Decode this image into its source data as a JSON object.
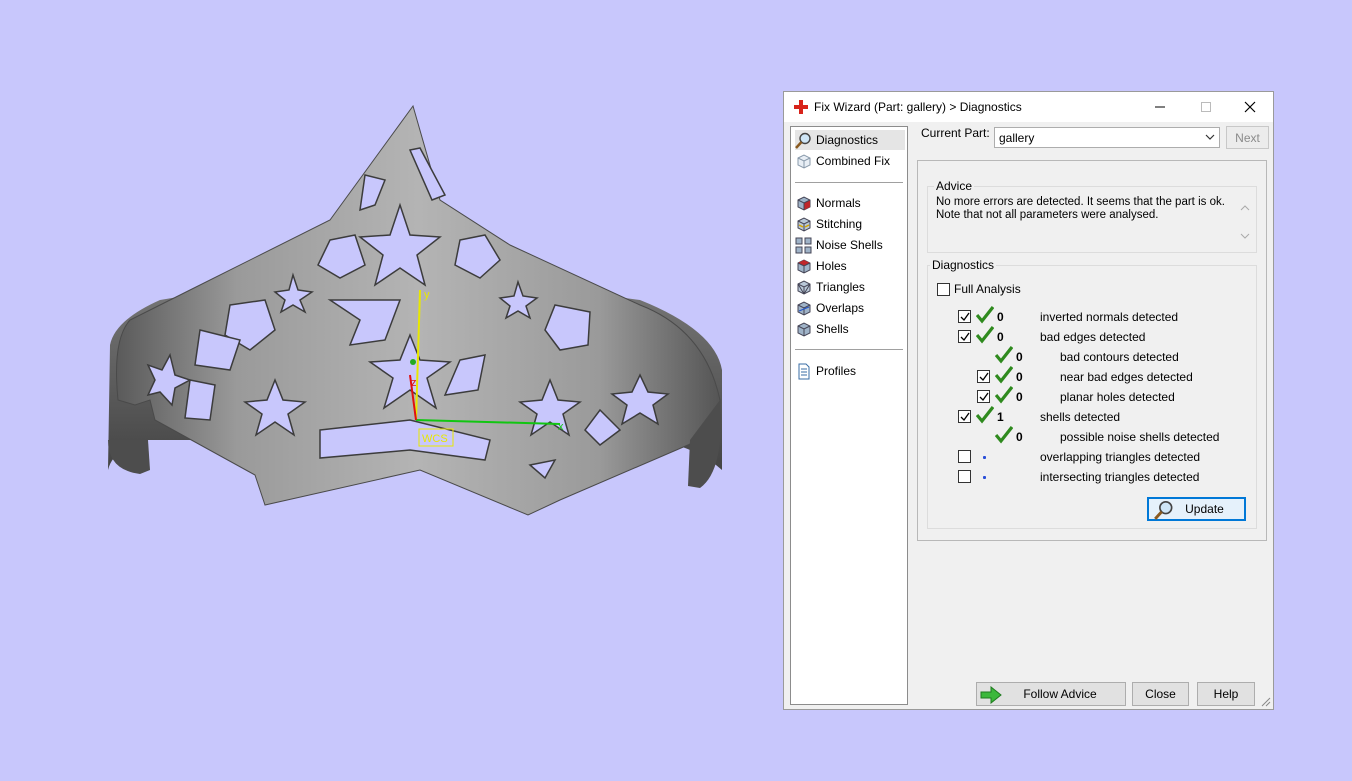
{
  "viewport": {
    "axis_labels": {
      "y": "y",
      "z": "z",
      "x": "x"
    },
    "wcs_label": "WCS"
  },
  "dialog": {
    "title": "Fix Wizard (Part: gallery) > Diagnostics",
    "window_buttons": {
      "minimize": "—",
      "maximize": "☐",
      "close": "✕"
    },
    "nav": {
      "top_items": [
        {
          "label": "Diagnostics",
          "icon": "magnifier-icon"
        },
        {
          "label": "Combined Fix",
          "icon": "cube-outline-icon"
        }
      ],
      "tool_items": [
        {
          "label": "Normals",
          "icon": "normals-cube-icon"
        },
        {
          "label": "Stitching",
          "icon": "stitching-cube-icon"
        },
        {
          "label": "Noise Shells",
          "icon": "noise-shells-icon"
        },
        {
          "label": "Holes",
          "icon": "holes-cube-icon"
        },
        {
          "label": "Triangles",
          "icon": "triangles-cube-icon"
        },
        {
          "label": "Overlaps",
          "icon": "overlaps-cube-icon"
        },
        {
          "label": "Shells",
          "icon": "shells-cube-icon"
        }
      ],
      "profiles_label": "Profiles"
    },
    "current_part_label": "Current Part:",
    "current_part_value": "gallery",
    "next_label": "Next",
    "advice": {
      "title": "Advice",
      "text": "No more errors are detected. It seems that the part is ok.\nNote that not all parameters were analysed."
    },
    "diagnostics": {
      "title": "Diagnostics",
      "full_analysis_label": "Full Analysis",
      "rows": [
        {
          "count": "0",
          "text": "inverted normals detected"
        },
        {
          "count": "0",
          "text": "bad edges detected"
        },
        {
          "count": "0",
          "text": "bad contours detected"
        },
        {
          "count": "0",
          "text": "near bad edges detected"
        },
        {
          "count": "0",
          "text": "planar holes detected"
        },
        {
          "count": "1",
          "text": "shells detected"
        },
        {
          "count": "0",
          "text": "possible noise shells detected"
        },
        {
          "count": "",
          "text": "overlapping triangles detected"
        },
        {
          "count": "",
          "text": "intersecting triangles detected"
        }
      ],
      "update_label": "Update"
    },
    "footer": {
      "follow_advice_label": "Follow Advice",
      "close_label": "Close",
      "help_label": "Help"
    },
    "colors": {
      "check_green": "#2f8a1e",
      "accent_blue": "#0078d7",
      "title_icon_red": "#d8231a"
    }
  }
}
